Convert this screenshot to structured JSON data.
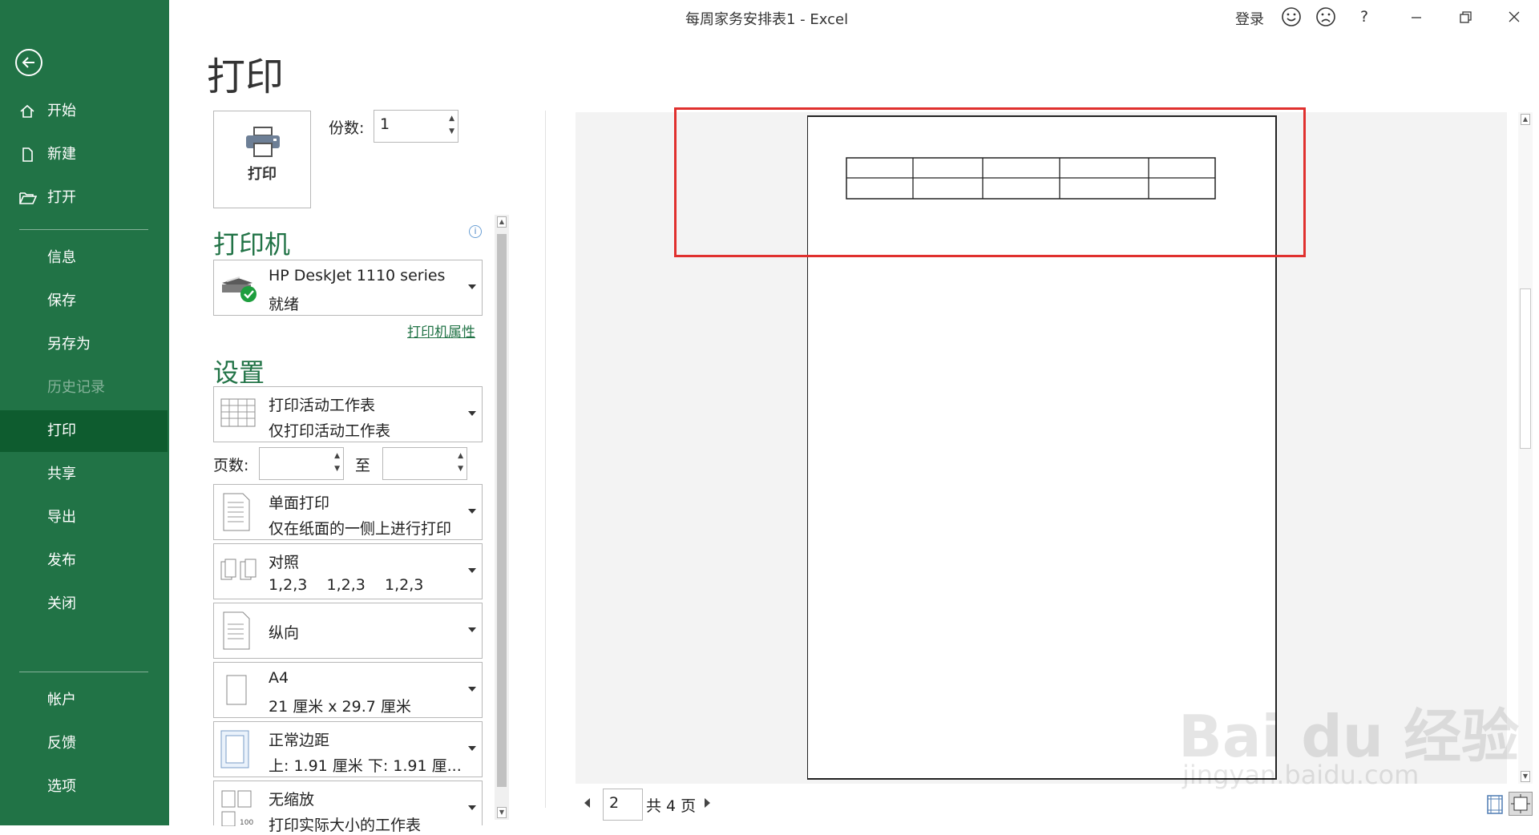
{
  "window": {
    "title": "每周家务安排表1  -  Excel",
    "sign_in": "登录",
    "help": "?"
  },
  "nav": {
    "items": [
      {
        "label": "开始"
      },
      {
        "label": "新建"
      },
      {
        "label": "打开"
      },
      {
        "label": "信息"
      },
      {
        "label": "保存"
      },
      {
        "label": "另存为"
      },
      {
        "label": "历史记录"
      },
      {
        "label": "打印"
      },
      {
        "label": "共享"
      },
      {
        "label": "导出"
      },
      {
        "label": "发布"
      },
      {
        "label": "关闭"
      },
      {
        "label": "帐户"
      },
      {
        "label": "反馈"
      },
      {
        "label": "选项"
      }
    ]
  },
  "print": {
    "heading": "打印",
    "button_label": "打印",
    "copies_label": "份数:",
    "copies_value": "1"
  },
  "printer": {
    "heading": "打印机",
    "name": "HP DeskJet 1110 series",
    "status": "就绪",
    "properties_link": "打印机属性"
  },
  "settings": {
    "heading": "设置",
    "what": {
      "line1": "打印活动工作表",
      "line2": "仅打印活动工作表"
    },
    "pages_label": "页数:",
    "pages_to": "至",
    "sides": {
      "line1": "单面打印",
      "line2": "仅在纸面的一侧上进行打印"
    },
    "collate": {
      "line1": "对照",
      "line2": "1,2,3    1,2,3    1,2,3"
    },
    "orientation": {
      "label": "纵向"
    },
    "paper": {
      "line1": "A4",
      "line2": "21 厘米 x 29.7 厘米"
    },
    "margins": {
      "line1": "正常边距",
      "line2": "上: 1.91 厘米 下: 1.91 厘..."
    },
    "scaling": {
      "line1": "无缩放",
      "line2": "打印实际大小的工作表"
    }
  },
  "preview": {
    "current_page": "2",
    "total_pages": "共 4 页"
  },
  "watermark": {
    "brand": "Bai  du 经验",
    "url": "jingyan.baidu.com"
  }
}
